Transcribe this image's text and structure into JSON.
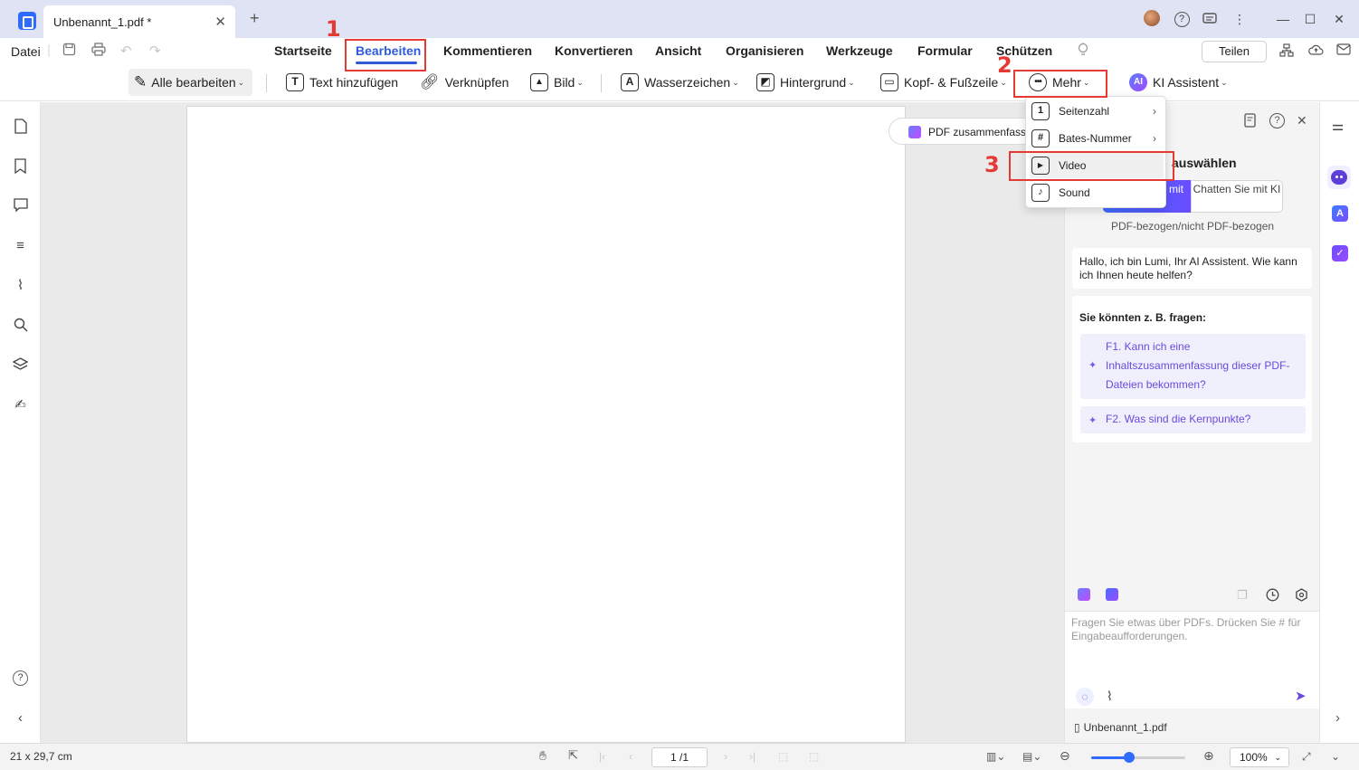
{
  "titlebar": {
    "tab_name": "Unbenannt_1.pdf *",
    "close": "✕",
    "new_tab": "+",
    "more": "⋮",
    "minimize": "—",
    "maximize": "☐",
    "close_window": "✕"
  },
  "menubar": {
    "datei": "Datei",
    "tabs": [
      "Startseite",
      "Bearbeiten",
      "Kommentieren",
      "Konvertieren",
      "Ansicht",
      "Organisieren",
      "Werkzeuge",
      "Formular",
      "Schützen"
    ],
    "active_tab": "Bearbeiten",
    "share": "Teilen"
  },
  "toolbar": {
    "edit_all": "Alle bearbeiten",
    "add_text": "Text hinzufügen",
    "link": "Verknüpfen",
    "image": "Bild",
    "watermark": "Wasserzeichen",
    "background": "Hintergrund",
    "header_footer": "Kopf- & Fußzeile",
    "more": "Mehr",
    "ai_assistant": "KI Assistent",
    "ai_badge": "AI"
  },
  "dropdown": {
    "items": [
      {
        "label": "Seitenzahl",
        "icon_text": "1"
      },
      {
        "label": "Bates-Nummer",
        "icon_text": "#"
      },
      {
        "label": "Video",
        "icon_text": "▶"
      },
      {
        "label": "Sound",
        "icon_text": "♪"
      }
    ]
  },
  "canvas": {
    "summarize": "PDF zusammenfasse"
  },
  "ai_panel": {
    "heading": "auswählen",
    "mode_a": "mit",
    "mode_b": "Chatten Sie mit KI",
    "mode_sub": "PDF-bezogen/nicht PDF-bezogen",
    "greeting": "Hallo, ich bin Lumi, Ihr AI Assistent. Wie kann ich Ihnen heute helfen?",
    "suggest_title": "Sie könnten z. B. fragen:",
    "q1": "F1. Kann ich eine Inhaltszusammenfassung dieser PDF-Dateien bekommen?",
    "q2": "F2. Was sind die Kernpunkte?",
    "input_placeholder": "Fragen Sie etwas über PDFs. Drücken Sie # für Eingabeaufforderungen.",
    "file_name": "Unbenannt_1.pdf"
  },
  "statusbar": {
    "page_size": "21 x 29,7 cm",
    "page_indicator": "1 /1",
    "zoom": "100%",
    "zoom_level": 0.4
  },
  "annotations": {
    "n1": "1",
    "n2": "2",
    "n3": "3",
    "color": "#e53935"
  },
  "colors": {
    "accent": "#2f5bd9",
    "titlebar": "#dfe3f3"
  }
}
